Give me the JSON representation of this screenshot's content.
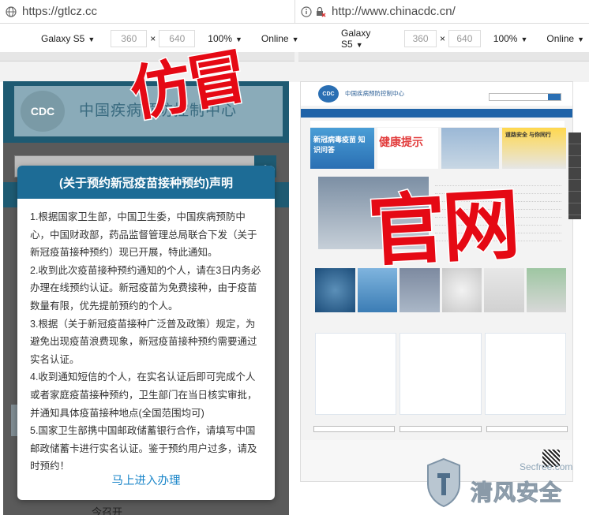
{
  "left_browser": {
    "url": "https://gtlcz.cc",
    "device": "Galaxy S5",
    "width": "360",
    "times": "×",
    "height": "640",
    "zoom": "100%",
    "network": "Online"
  },
  "right_browser": {
    "url": "http://www.chinacdc.cn/",
    "device": "Galaxy S5",
    "width": "360",
    "times": "×",
    "height": "640",
    "zoom": "100%",
    "network": "Online"
  },
  "fake_site": {
    "logo_text": "CDC",
    "title": "中国疾病预防控制中心",
    "bottom_text": "今召开",
    "modal": {
      "title": "(关于预约新冠疫苗接种预约)声明",
      "paragraphs": [
        "1.根据国家卫生部，中国卫生委，中国疾病预防中心，中国财政部，药品监督管理总局联合下发（关于新冠疫苗接种预约）现已开展，特此通知。",
        "2.收到此次疫苗接种预约通知的个人，请在3日内务必办理在线预约认证。新冠疫苗为免费接种，由于疫苗数量有限，优先提前预约的个人。",
        "3.根据（关于新冠疫苗接种广泛普及政策）规定，为避免出现疫苗浪费现象，新冠疫苗接种预约需要通过实名认证。",
        "4.收到通知短信的个人，在实名认证后即可完成个人或者家庭疫苗接种预约，卫生部门在当日核实审批，并通知具体疫苗接种地点(全国范围均可)",
        "5.国家卫生部携中国邮政储蓄银行合作，请填写中国邮政储蓄卡进行实名认证。鉴于预约用户过多，请及时预约！"
      ],
      "action_link": "马上进入办理"
    }
  },
  "official_site": {
    "logo_text": "CDC",
    "site_name": "中国疾病预防控制中心",
    "banner_1": "新冠病毒疫苗 知识问答",
    "banner_2": "健康提示",
    "banner_4": "道路安全 与你同行"
  },
  "stamps": {
    "fake": "仿冒",
    "official": "官网"
  },
  "watermark": {
    "site": "Secfree.com",
    "brand": "清风安全"
  },
  "colors": {
    "stamp_red": "#e50914",
    "modal_header": "#1d6c96",
    "link_blue": "#1b86c9",
    "official_nav": "#1f63a8"
  }
}
